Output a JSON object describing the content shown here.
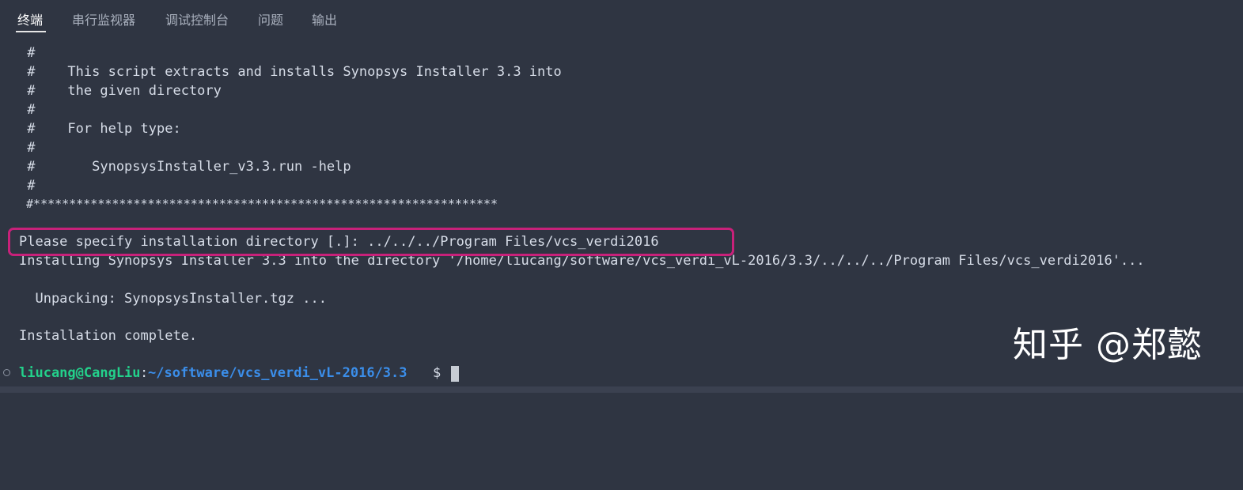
{
  "tabs": [
    {
      "label": "终端",
      "active": true
    },
    {
      "label": "串行监视器",
      "active": false
    },
    {
      "label": "调试控制台",
      "active": false
    },
    {
      "label": "问题",
      "active": false
    },
    {
      "label": "输出",
      "active": false
    }
  ],
  "terminal": {
    "lines": [
      " #",
      " #    This script extracts and installs Synopsys Installer 3.3 into",
      " #    the given directory",
      " #",
      " #    For help type:",
      " #",
      " #       SynopsysInstaller_v3.3.run -help",
      " #",
      " #*****************************************************************"
    ],
    "highlighted_line": "Please specify installation directory [.]: ../../../Program Files/vcs_verdi2016",
    "clipped_line": "Installing Synopsys Installer 3.3 into the directory '/home/liucang/software/vcs_verdi_vL-2016/3.3/../../../Program Files/vcs_verdi2016'...",
    "unpacking_line": "  Unpacking: SynopsysInstaller.tgz ...",
    "complete_line": "Installation complete.",
    "prompt": {
      "user_host": "liucang@CangLiu",
      "separator": ":",
      "path": "~/software/vcs_verdi_vL-2016/3.3",
      "symbol": "$"
    }
  },
  "watermark": "知乎 @郑懿",
  "colors": {
    "background": "#2f3542",
    "text": "#d7dde8",
    "prompt_user": "#23d18b",
    "prompt_path": "#3b8eea",
    "highlight_border": "#c8217a"
  }
}
